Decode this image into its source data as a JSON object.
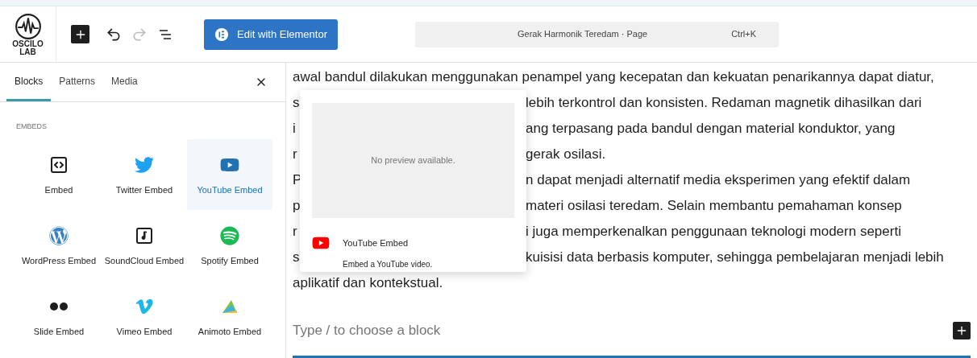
{
  "header": {
    "logo": {
      "line1": "OSCILO",
      "line2": "LAB"
    },
    "redo_disabled": true,
    "edit_button": "Edit with Elementor",
    "command_bar": {
      "title": "Gerak Harmonik Teredam · Page",
      "shortcut": "Ctrl+K"
    }
  },
  "sidebar": {
    "tabs": [
      {
        "label": "Blocks",
        "selected": true
      },
      {
        "label": "Patterns",
        "selected": false
      },
      {
        "label": "Media",
        "selected": false
      }
    ],
    "category": "EMBEDS",
    "blocks": [
      {
        "label": "Embed",
        "kind": "embed",
        "selected": false
      },
      {
        "label": "Twitter Embed",
        "kind": "twitter",
        "selected": false
      },
      {
        "label": "YouTube Embed",
        "kind": "youtube",
        "selected": true
      },
      {
        "label": "WordPress Embed",
        "kind": "wordpress",
        "selected": false
      },
      {
        "label": "SoundCloud Embed",
        "kind": "soundcloud",
        "selected": false
      },
      {
        "label": "Spotify Embed",
        "kind": "spotify",
        "selected": false
      },
      {
        "label": "Slide Embed",
        "kind": "flickr",
        "selected": false
      },
      {
        "label": "Vimeo Embed",
        "kind": "vimeo",
        "selected": false
      },
      {
        "label": "Animoto Embed",
        "kind": "animoto",
        "selected": false
      }
    ]
  },
  "editor": {
    "lines": [
      {
        "kind": "full",
        "text": "awal bandul dilakukan menggunakan penampel yang kecepatan dan kekuatan penarikannya dapat diatur,"
      },
      {
        "kind": "split",
        "left": "s",
        "right": "lebih terkontrol dan konsisten. Redaman magnetik dihasilkan dari"
      },
      {
        "kind": "split",
        "left": "i",
        "right": "ang terpasang pada bandul dengan material konduktor, yang"
      },
      {
        "kind": "split",
        "left": "r",
        "right": "gerak osilasi."
      },
      {
        "kind": "split",
        "left": "P",
        "right": "n dapat menjadi alternatif media eksperimen yang efektif dalam"
      },
      {
        "kind": "split",
        "left": "p",
        "right": "materi osilasi teredam. Selain membantu pemahaman konsep"
      },
      {
        "kind": "split",
        "left": "r",
        "right": "i juga memperkenalkan penggunaan teknologi modern seperti"
      },
      {
        "kind": "split",
        "left": "s",
        "right": "kuisisi data berbasis komputer, sehingga pembelajaran menjadi lebih"
      },
      {
        "kind": "full",
        "text": "aplikatif dan kontekstual."
      }
    ],
    "placeholder": "Type / to choose a block"
  },
  "popover": {
    "preview": "No preview available.",
    "title": "YouTube Embed",
    "description": "Embed a YouTube video."
  }
}
